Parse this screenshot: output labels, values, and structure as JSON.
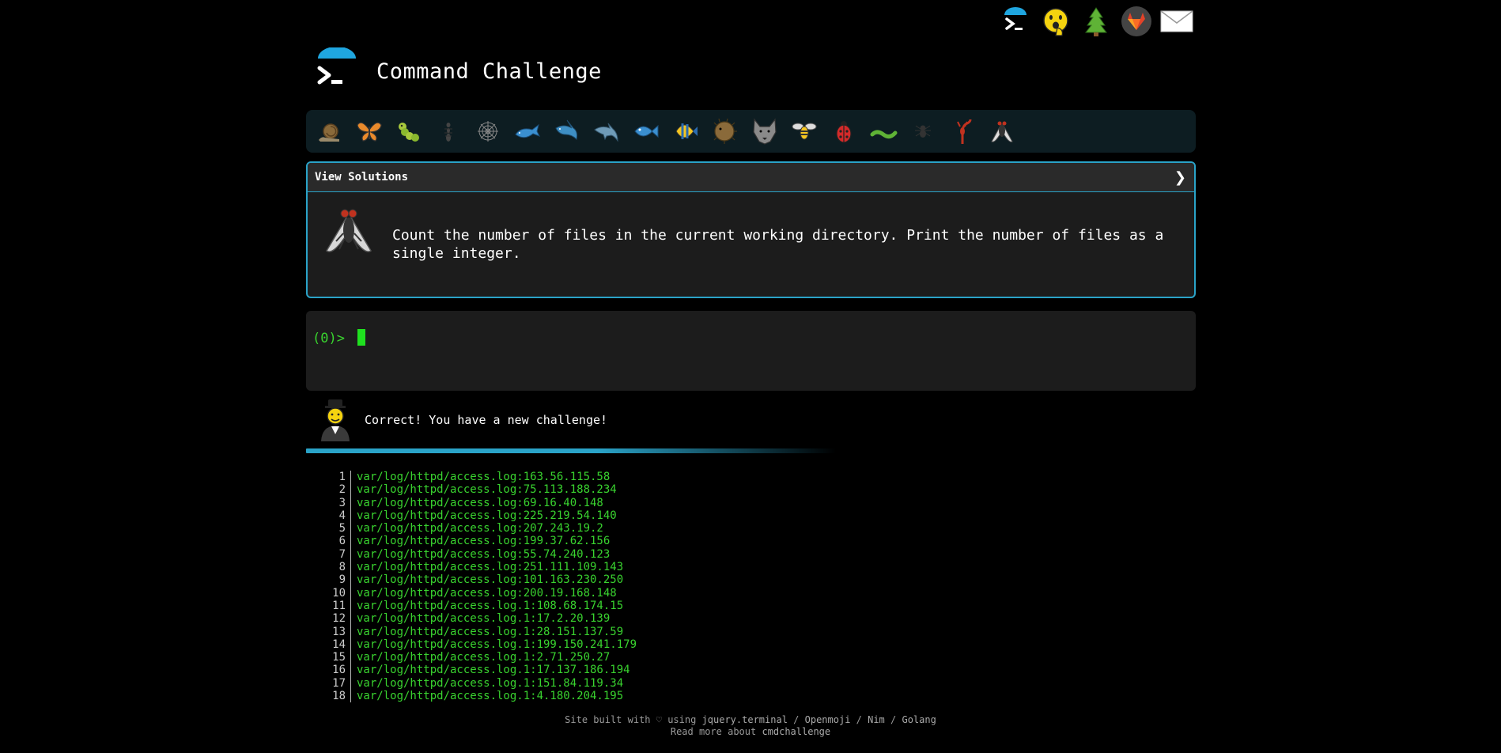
{
  "top_icons": [
    "terminal-logo-icon",
    "surprised-face-icon",
    "christmas-tree-icon",
    "gitlab-fox-icon",
    "envelope-icon"
  ],
  "header": {
    "title": "Command Challenge"
  },
  "emoji_bar": [
    "snail",
    "butterfly",
    "caterpillar",
    "ant",
    "spider-web",
    "whale",
    "shark",
    "dolphin",
    "fish",
    "tropical-fish",
    "blowfish",
    "wolf",
    "bee",
    "lady-beetle",
    "worm",
    "spider",
    "scorpion",
    "fly"
  ],
  "challenge": {
    "toggle_label": "View Solutions",
    "chevron": "❯",
    "text": "Count the number of files in the current working directory. Print the number of files as a single integer."
  },
  "terminal": {
    "prompt": "(0)> "
  },
  "feedback": {
    "message": "Correct! You have a new challenge!"
  },
  "log_lines": [
    {
      "n": "1",
      "t": "var/log/httpd/access.log:163.56.115.58"
    },
    {
      "n": "2",
      "t": "var/log/httpd/access.log:75.113.188.234"
    },
    {
      "n": "3",
      "t": "var/log/httpd/access.log:69.16.40.148"
    },
    {
      "n": "4",
      "t": "var/log/httpd/access.log:225.219.54.140"
    },
    {
      "n": "5",
      "t": "var/log/httpd/access.log:207.243.19.2"
    },
    {
      "n": "6",
      "t": "var/log/httpd/access.log:199.37.62.156"
    },
    {
      "n": "7",
      "t": "var/log/httpd/access.log:55.74.240.123"
    },
    {
      "n": "8",
      "t": "var/log/httpd/access.log:251.111.109.143"
    },
    {
      "n": "9",
      "t": "var/log/httpd/access.log:101.163.230.250"
    },
    {
      "n": "10",
      "t": "var/log/httpd/access.log:200.19.168.148"
    },
    {
      "n": "11",
      "t": "var/log/httpd/access.log.1:108.68.174.15"
    },
    {
      "n": "12",
      "t": "var/log/httpd/access.log.1:17.2.20.139"
    },
    {
      "n": "13",
      "t": "var/log/httpd/access.log.1:28.151.137.59"
    },
    {
      "n": "14",
      "t": "var/log/httpd/access.log.1:199.150.241.179"
    },
    {
      "n": "15",
      "t": "var/log/httpd/access.log.1:2.71.250.27"
    },
    {
      "n": "16",
      "t": "var/log/httpd/access.log.1:17.137.186.194"
    },
    {
      "n": "17",
      "t": "var/log/httpd/access.log.1:151.84.119.34"
    },
    {
      "n": "18",
      "t": "var/log/httpd/access.log.1:4.180.204.195"
    }
  ],
  "footer": {
    "prefix": "Site built with ",
    "heart": "♡",
    "using": " using ",
    "link1": "jquery.terminal",
    "sep1": " / ",
    "link2": "Openmoji",
    "sep2": " / ",
    "link3": "Nim",
    "sep3": " / ",
    "link4": "Golang",
    "read_prefix": "Read more about ",
    "read_link": "cmdchallenge"
  },
  "colors": {
    "accent": "#2aa3c8",
    "prompt": "#39d32f",
    "cursor": "#1fe01f"
  }
}
